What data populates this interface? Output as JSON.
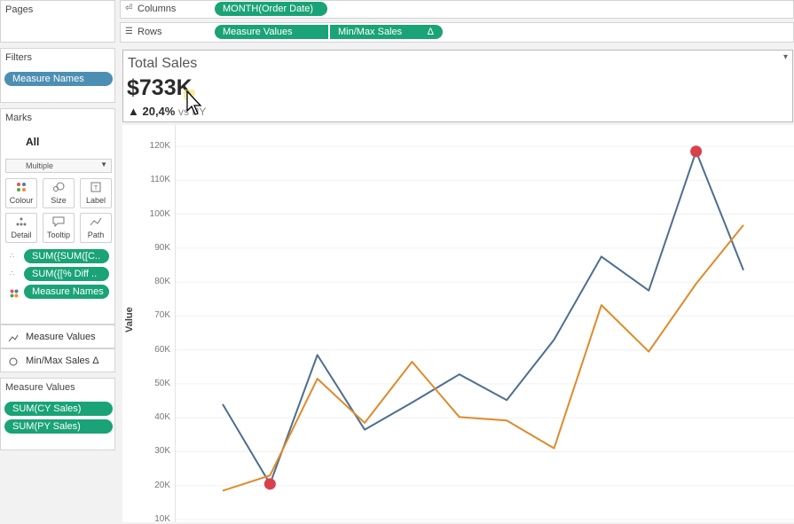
{
  "left_panel": {
    "pages_title": "Pages",
    "filters_title": "Filters",
    "filters": [
      "Measure Names"
    ],
    "marks_title": "Marks",
    "marks_all": "All",
    "mark_type": "Multiple",
    "mark_buttons": [
      {
        "icon": "colour-icon",
        "label": "Colour"
      },
      {
        "icon": "size-icon",
        "label": "Size"
      },
      {
        "icon": "label-icon",
        "label": "Label"
      },
      {
        "icon": "detail-icon",
        "label": "Detail"
      },
      {
        "icon": "tooltip-icon",
        "label": "Tooltip"
      },
      {
        "icon": "path-icon",
        "label": "Path"
      }
    ],
    "mark_fields": [
      "SUM({SUM([C..",
      "SUM({[% Diff ..",
      "Measure Names"
    ],
    "mark_layers": [
      "Measure Values",
      "Min/Max Sales Δ"
    ],
    "measure_values_title": "Measure Values",
    "measure_values": [
      "SUM(CY Sales)",
      "SUM(PY Sales)"
    ]
  },
  "shelves": {
    "columns_label": "Columns",
    "columns_pill": "MONTH(Order Date)",
    "rows_label": "Rows",
    "rows_pills": [
      "Measure Values",
      "Min/Max Sales"
    ],
    "delta_symbol": "Δ"
  },
  "kpi": {
    "title": "Total Sales",
    "value": "$733K",
    "change": "▲ 20,4%",
    "suffix": "vs PY",
    "dropdown": "▾"
  },
  "chart_data": {
    "type": "line",
    "ylabel": "Value",
    "ylim": [
      10000,
      124000
    ],
    "yticks": [
      "120K",
      "110K",
      "100K",
      "90K",
      "80K",
      "70K",
      "60K",
      "50K",
      "40K",
      "30K",
      "20K",
      "10K"
    ],
    "x": [
      1,
      2,
      3,
      4,
      5,
      6,
      7,
      8,
      9,
      10,
      11,
      12
    ],
    "series": [
      {
        "values": [
          44000,
          20500,
          58500,
          36500,
          44500,
          52800,
          45200,
          63000,
          87500,
          77500,
          118500,
          83500
        ],
        "color": "#4e6e8e"
      },
      {
        "values": [
          18500,
          23000,
          51500,
          38500,
          56500,
          40200,
          39200,
          31000,
          73200,
          59500,
          79500,
          96800
        ],
        "color": "#e08a2a"
      }
    ],
    "markers": [
      {
        "x": 2,
        "y": 20500,
        "color": "#d9404b"
      },
      {
        "x": 11,
        "y": 118500,
        "color": "#d9404b"
      }
    ]
  }
}
